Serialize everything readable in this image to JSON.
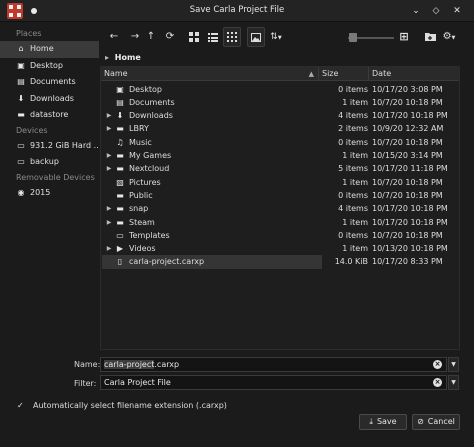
{
  "window": {
    "title": "Save Carla Project File",
    "collapse_glyph": "⌄",
    "restore_glyph": "◇",
    "close_glyph": "✕"
  },
  "toolbar": {
    "back_glyph": "←",
    "forward_glyph": "→",
    "up_glyph": "↑",
    "reload_glyph": "⟳",
    "zoom_level": 0.1
  },
  "sidebar": {
    "places_heading": "Places",
    "places": [
      {
        "label": "Home",
        "icon": "home-icon",
        "glyph": "⌂",
        "active": true
      },
      {
        "label": "Desktop",
        "icon": "desktop-icon",
        "glyph": "▣"
      },
      {
        "label": "Documents",
        "icon": "documents-icon",
        "glyph": "▤"
      },
      {
        "label": "Downloads",
        "icon": "downloads-icon",
        "glyph": "⬇"
      },
      {
        "label": "datastore",
        "icon": "folder-icon",
        "glyph": "▬"
      }
    ],
    "devices_heading": "Devices",
    "devices": [
      {
        "label": "931.2 GiB Hard ...",
        "icon": "hard-drive-icon",
        "glyph": "▭"
      },
      {
        "label": "backup",
        "icon": "hard-drive-icon",
        "glyph": "▭"
      }
    ],
    "removable_heading": "Removable Devices",
    "removable": [
      {
        "label": "2015",
        "icon": "optical-disc-icon",
        "glyph": "◉"
      }
    ]
  },
  "breadcrumb": {
    "arrow": "▸",
    "current": "Home"
  },
  "file_list": {
    "columns": {
      "name": "Name",
      "size": "Size",
      "date": "Date",
      "sort_glyph": "▲"
    },
    "rows": [
      {
        "name": "Desktop",
        "size": "0 items",
        "date": "10/17/20 3:08 PM",
        "expandable": false,
        "icon": "desktop-folder-icon",
        "glyph": "▣"
      },
      {
        "name": "Documents",
        "size": "1 item",
        "date": "10/7/20 10:18 PM",
        "expandable": false,
        "icon": "documents-folder-icon",
        "glyph": "▤"
      },
      {
        "name": "Downloads",
        "size": "4 items",
        "date": "10/17/20 10:18 PM",
        "expandable": true,
        "icon": "downloads-folder-icon",
        "glyph": "⬇"
      },
      {
        "name": "LBRY",
        "size": "2 items",
        "date": "10/9/20 12:32 AM",
        "expandable": true,
        "icon": "folder-icon",
        "glyph": "▬"
      },
      {
        "name": "Music",
        "size": "0 items",
        "date": "10/7/20 10:18 PM",
        "expandable": false,
        "icon": "music-folder-icon",
        "glyph": "♫"
      },
      {
        "name": "My Games",
        "size": "1 item",
        "date": "10/15/20 3:14 PM",
        "expandable": true,
        "icon": "folder-icon",
        "glyph": "▬"
      },
      {
        "name": "Nextcloud",
        "size": "5 items",
        "date": "10/17/20 11:18 PM",
        "expandable": true,
        "icon": "folder-icon",
        "glyph": "▬"
      },
      {
        "name": "Pictures",
        "size": "1 item",
        "date": "10/7/20 10:18 PM",
        "expandable": false,
        "icon": "pictures-folder-icon",
        "glyph": "▧"
      },
      {
        "name": "Public",
        "size": "0 items",
        "date": "10/7/20 10:18 PM",
        "expandable": false,
        "icon": "public-folder-icon",
        "glyph": "▬"
      },
      {
        "name": "snap",
        "size": "4 items",
        "date": "10/17/20 10:18 PM",
        "expandable": true,
        "icon": "folder-icon",
        "glyph": "▬"
      },
      {
        "name": "Steam",
        "size": "1 item",
        "date": "10/17/20 10:18 PM",
        "expandable": true,
        "icon": "folder-icon",
        "glyph": "▬"
      },
      {
        "name": "Templates",
        "size": "0 items",
        "date": "10/7/20 10:18 PM",
        "expandable": false,
        "icon": "templates-folder-icon",
        "glyph": "▭"
      },
      {
        "name": "Videos",
        "size": "1 item",
        "date": "10/13/20 10:18 PM",
        "expandable": true,
        "icon": "videos-folder-icon",
        "glyph": "▶"
      },
      {
        "name": "carla-project.carxp",
        "size": "14.0 KiB",
        "date": "10/17/20 8:33 PM",
        "expandable": false,
        "icon": "file-icon",
        "glyph": "▯",
        "selected": true
      }
    ]
  },
  "name_field": {
    "label": "Name:",
    "value_selected_part": "carla-project",
    "value_rest": ".carxp",
    "clear_glyph": "×",
    "dropdown_glyph": "▼"
  },
  "filter_field": {
    "label": "Filter:",
    "value": "Carla Project File",
    "clear_glyph": "×",
    "dropdown_glyph": "▼"
  },
  "auto_extension": {
    "checked_glyph": "✓",
    "label": "Automatically select filename extension (.carxp)"
  },
  "buttons": {
    "save": {
      "label": "Save",
      "glyph": "⤓"
    },
    "cancel": {
      "label": "Cancel",
      "glyph": "⊘"
    }
  }
}
